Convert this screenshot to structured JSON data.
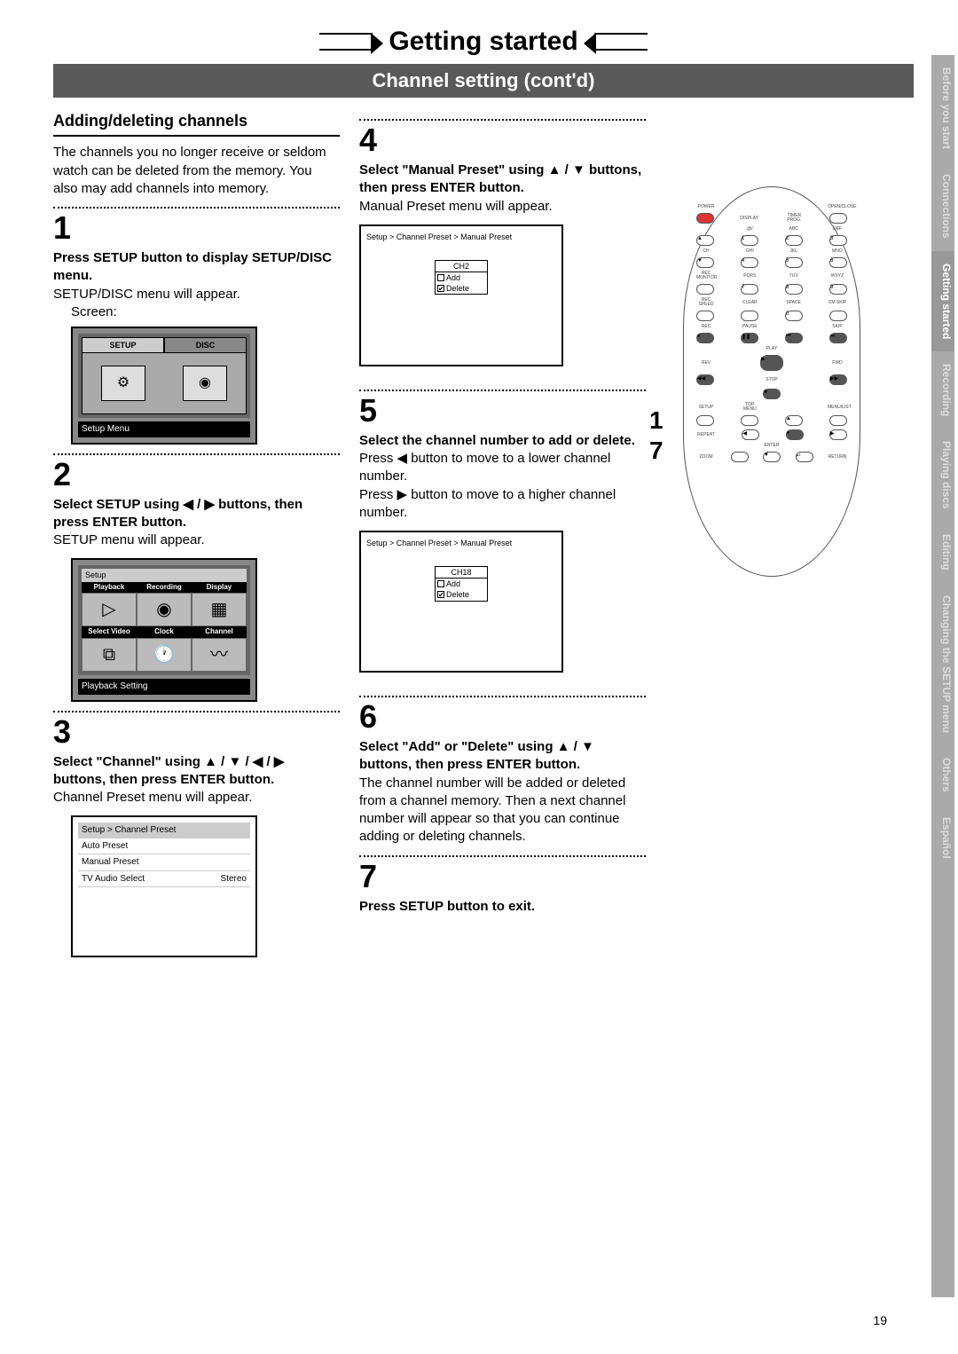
{
  "header": {
    "title": "Getting started",
    "subtitle": "Channel setting (cont'd)"
  },
  "section": {
    "heading": "Adding/deleting channels",
    "intro": "The channels you no longer receive or seldom watch can be deleted from the memory. You also may add channels into memory."
  },
  "steps": {
    "s1": {
      "n": "1",
      "bold": "Press SETUP button to display SETUP/DISC menu.",
      "text": "SETUP/DISC menu will appear.",
      "screen_label": "Screen:",
      "tab1": "SETUP",
      "tab2": "DISC",
      "cap": "Setup Menu"
    },
    "s2": {
      "n": "2",
      "bold": "Select SETUP using ◀ / ▶ buttons, then press ENTER button.",
      "text": "SETUP menu will appear.",
      "setup_label": "Setup",
      "cells": [
        "Playback",
        "Recording",
        "Display",
        "Select Video",
        "Clock",
        "Channel"
      ],
      "cap": "Playback Setting"
    },
    "s3": {
      "n": "3",
      "bold": "Select \"Channel\" using ▲ / ▼ / ◀ / ▶ buttons, then press ENTER button.",
      "text": "Channel Preset menu will appear.",
      "menu_title": "Setup > Channel Preset",
      "rows": [
        "Auto Preset",
        "Manual Preset",
        "TV Audio Select"
      ],
      "stereo": "Stereo"
    },
    "s4": {
      "n": "4",
      "bold": "Select \"Manual Preset\" using ▲ / ▼ buttons, then press ENTER button.",
      "text": "Manual Preset menu will appear.",
      "head": "Setup > Channel Preset > Manual Preset",
      "ch": "CH2",
      "add": "Add",
      "del": "Delete"
    },
    "s5": {
      "n": "5",
      "bold": "Select the channel number to add or delete.",
      "t1": "Press ◀ button to move to a lower channel number.",
      "t2": "Press ▶ button to move to a higher channel number.",
      "head": "Setup > Channel Preset > Manual Preset",
      "ch": "CH18",
      "add": "Add",
      "del": "Delete"
    },
    "s6": {
      "n": "6",
      "bold": "Select \"Add\" or \"Delete\" using ▲ / ▼ buttons, then press ENTER button.",
      "text": "The channel number will be added or deleted from a channel memory. Then a next channel number will appear so that you can continue adding or deleting channels."
    },
    "s7": {
      "n": "7",
      "bold": "Press SETUP button to exit."
    }
  },
  "remote": {
    "labels": {
      "power": "POWER",
      "openclose": "OPEN/CLOSE",
      "display": "DISPLAY",
      "timer": "TIMER PROG.",
      "abc": "ABC",
      "def": "DEF",
      "ch": "CH",
      "ghi": "GHI",
      "jkl": "JKL",
      "mno": "MNO",
      "rec_monitor": "REC MONITOR",
      "pqrs": "PQRS",
      "tuv": "TUV",
      "wxyz": "WXYZ",
      "recspeed": "REC SPEED",
      "clear": "CLEAR",
      "space": "SPACE",
      "cmskip": "CM SKIP",
      "rec": "REC",
      "pause": "PAUSE",
      "skip": "SKIP",
      "play": "PLAY",
      "rev": "REV",
      "fwd": "FWD",
      "stop": "STOP",
      "setup": "SETUP",
      "topmenu": "TOP MENU",
      "menulist": "MENU/LIST",
      "repeat": "REPEAT",
      "enter": "ENTER",
      "zoom": "ZOOM",
      "return": "RETURN"
    },
    "nums": {
      "n1": "1",
      "n2": "2",
      "n3": "3",
      "n4": "4",
      "n5": "5",
      "n6": "6",
      "n7": "7"
    }
  },
  "sidebar": [
    "Before you start",
    "Connections",
    "Getting started",
    "Recording",
    "Playing discs",
    "Editing",
    "Changing the SETUP menu",
    "Others",
    "Español"
  ],
  "page_number": "19"
}
